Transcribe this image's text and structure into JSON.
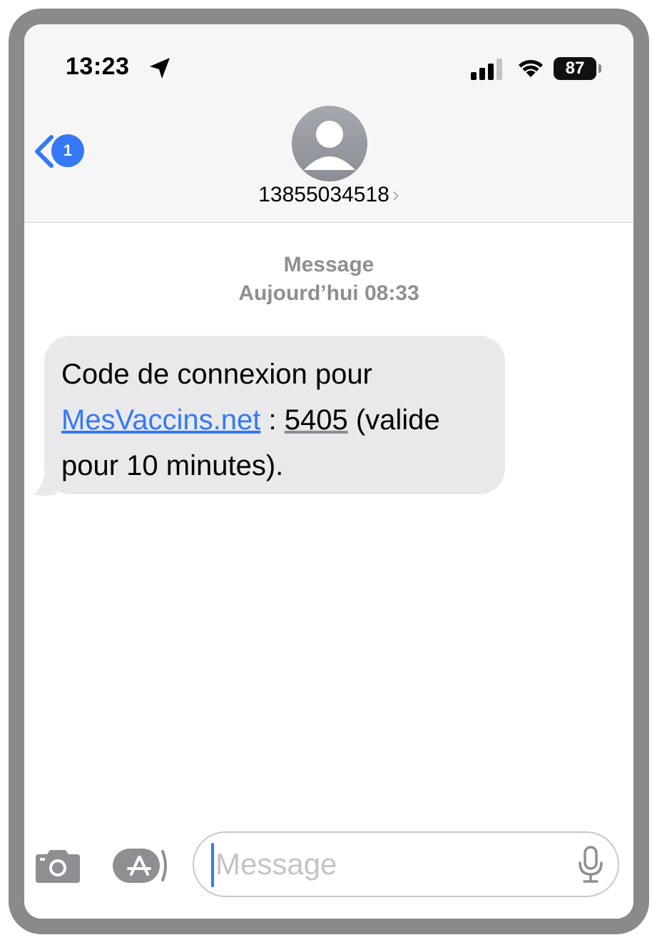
{
  "status_bar": {
    "time": "13:23",
    "battery": "87"
  },
  "header": {
    "back_badge": "1",
    "contact": "13855034518",
    "contact_chevron": "›"
  },
  "thread": {
    "service": "Message",
    "date": "Aujourd’hui 08:33"
  },
  "message": {
    "text_before_link": "Code de connexion pour ",
    "link": "MesVaccins.net",
    "text_before_code": " : ",
    "code": "5405",
    "text_after_code": " (valide pour 10 minutes)."
  },
  "composer": {
    "placeholder": "Message"
  },
  "icons": {
    "location": "location-arrow-icon",
    "signal": "cellular-signal-icon",
    "wifi": "wifi-icon",
    "back": "chevron-left-icon",
    "avatar": "person-icon",
    "camera": "camera-icon",
    "apps": "app-store-icon",
    "mic": "microphone-icon"
  },
  "colors": {
    "accent": "#3478f6",
    "bubble": "#e9e9eb",
    "secondary_text": "#8e8e93"
  }
}
